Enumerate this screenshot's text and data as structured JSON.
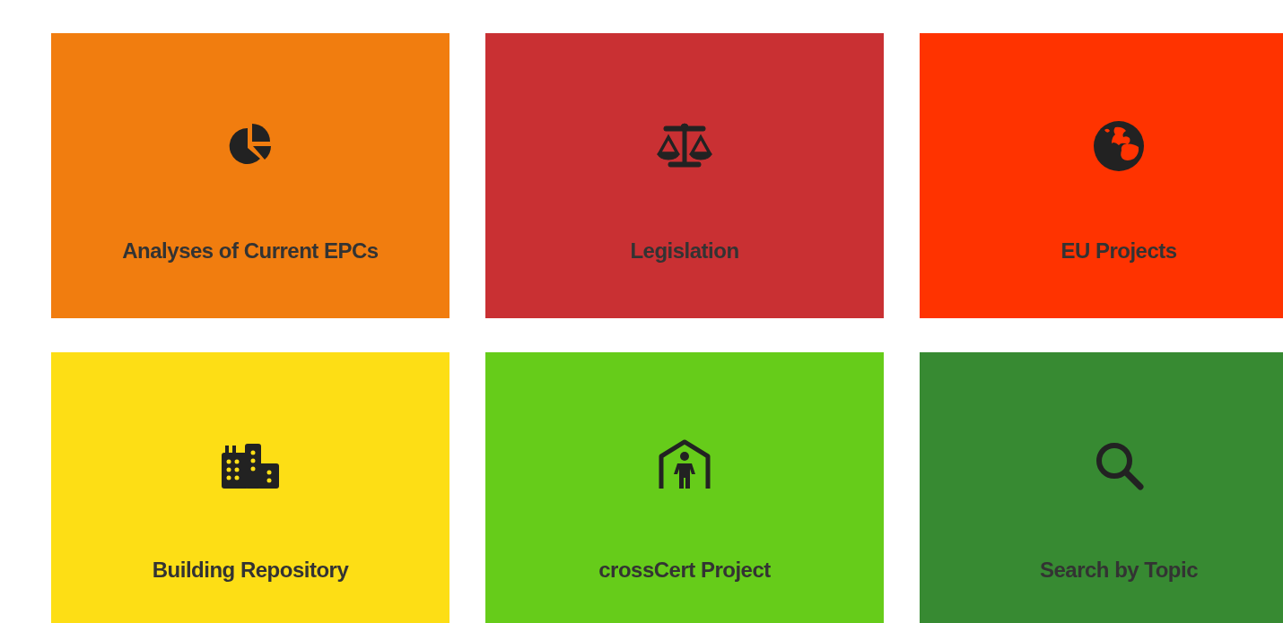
{
  "tiles": [
    {
      "label": "Analyses of Current EPCs",
      "kind": "pie",
      "color": "#f17d0f"
    },
    {
      "label": "Legislation",
      "kind": "scale",
      "color": "#c93033"
    },
    {
      "label": "EU Projects",
      "kind": "globe",
      "color": "#ff3300"
    },
    {
      "label": "Building Repository",
      "kind": "buildings",
      "color": "#fdde15"
    },
    {
      "label": "crossCert Project",
      "kind": "shelter",
      "color": "#66cc1a"
    },
    {
      "label": "Search by Topic",
      "kind": "search",
      "color": "#378a32"
    }
  ]
}
